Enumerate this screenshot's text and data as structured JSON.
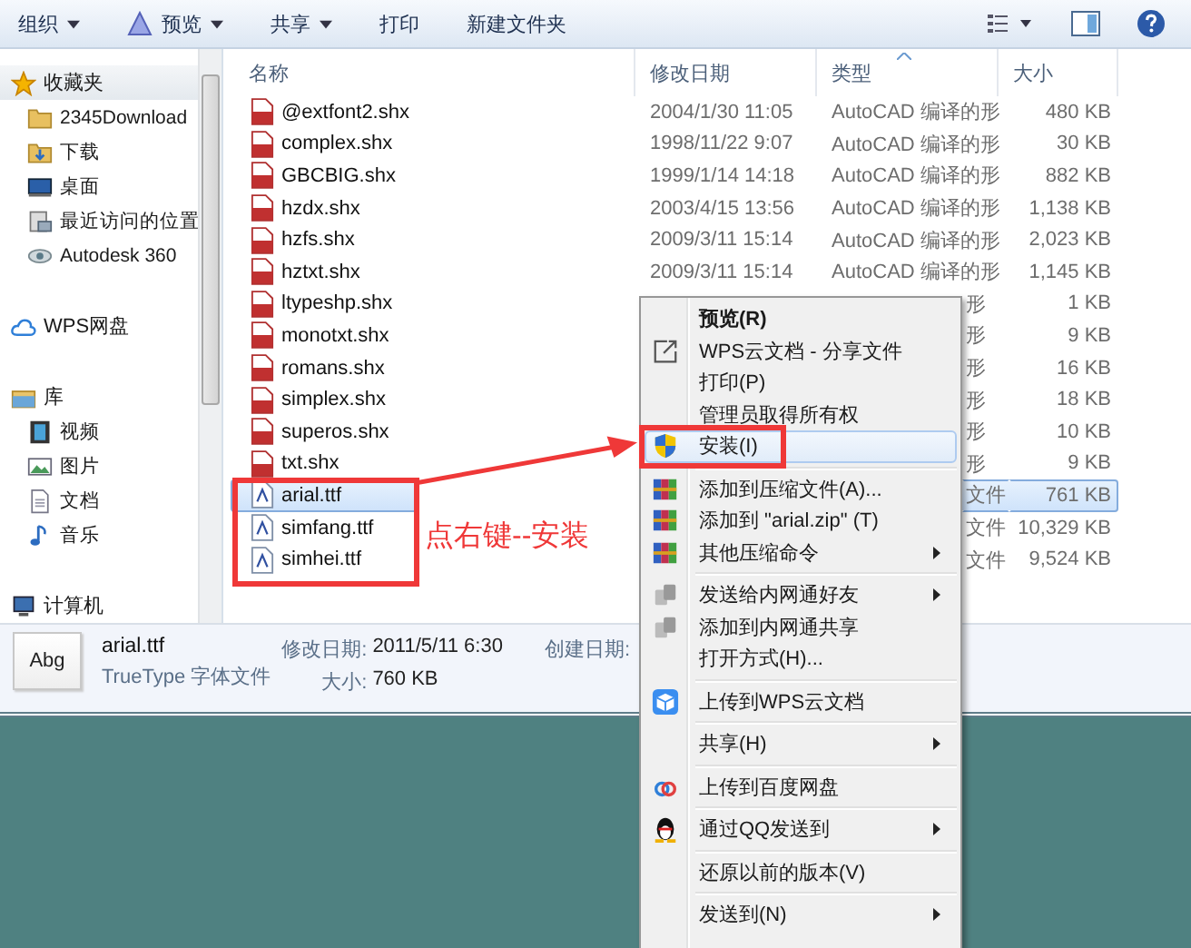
{
  "toolbar": {
    "items": [
      {
        "label": "组织",
        "dropdown": true
      },
      {
        "label": "预览",
        "dropdown": true
      },
      {
        "label": "共享",
        "dropdown": true
      },
      {
        "label": "打印",
        "dropdown": false
      },
      {
        "label": "新建文件夹",
        "dropdown": false
      }
    ]
  },
  "sidebar": {
    "groups": [
      {
        "label": "收藏夹",
        "children": [
          {
            "label": "2345Download"
          },
          {
            "label": "下载"
          },
          {
            "label": "桌面"
          },
          {
            "label": "最近访问的位置"
          },
          {
            "label": "Autodesk 360"
          }
        ]
      },
      {
        "label": "WPS网盘"
      },
      {
        "label": "库",
        "children": [
          {
            "label": "视频"
          },
          {
            "label": "图片"
          },
          {
            "label": "文档"
          },
          {
            "label": "音乐"
          }
        ]
      },
      {
        "label": "计算机"
      }
    ]
  },
  "table": {
    "columns": [
      "名称",
      "修改日期",
      "类型",
      "大小"
    ],
    "rows": [
      {
        "name": "@extfont2.shx",
        "kind": "shx",
        "date": "2004/1/30 11:05",
        "type": "AutoCAD 编译的形",
        "size": "480 KB",
        "selected": false
      },
      {
        "name": "complex.shx",
        "kind": "shx",
        "date": "1998/11/22 9:07",
        "type": "AutoCAD 编译的形",
        "size": "30 KB",
        "selected": false
      },
      {
        "name": "GBCBIG.shx",
        "kind": "shx",
        "date": "1999/1/14 14:18",
        "type": "AutoCAD 编译的形",
        "size": "882 KB",
        "selected": false
      },
      {
        "name": "hzdx.shx",
        "kind": "shx",
        "date": "2003/4/15 13:56",
        "type": "AutoCAD 编译的形",
        "size": "1,138 KB",
        "selected": false
      },
      {
        "name": "hzfs.shx",
        "kind": "shx",
        "date": "2009/3/11 15:14",
        "type": "AutoCAD 编译的形",
        "size": "2,023 KB",
        "selected": false
      },
      {
        "name": "hztxt.shx",
        "kind": "shx",
        "date": "2009/3/11 15:14",
        "type": "AutoCAD 编译的形",
        "size": "1,145 KB",
        "selected": false
      },
      {
        "name": "ltypeshp.shx",
        "kind": "shx",
        "type": "形",
        "size": "1 KB",
        "selected": false
      },
      {
        "name": "monotxt.shx",
        "kind": "shx",
        "type": "形",
        "size": "9 KB",
        "selected": false
      },
      {
        "name": "romans.shx",
        "kind": "shx",
        "type": "形",
        "size": "16 KB",
        "selected": false
      },
      {
        "name": "simplex.shx",
        "kind": "shx",
        "type": "形",
        "size": "18 KB",
        "selected": false
      },
      {
        "name": "superos.shx",
        "kind": "shx",
        "type": "形",
        "size": "10 KB",
        "selected": false
      },
      {
        "name": "txt.shx",
        "kind": "shx",
        "type": "形",
        "size": "9 KB",
        "selected": false
      },
      {
        "name": "arial.ttf",
        "kind": "ttf",
        "type": "文件",
        "size": "761 KB",
        "selected": true
      },
      {
        "name": "simfang.ttf",
        "kind": "ttf",
        "type": "文件",
        "size": "10,329 KB",
        "selected": false
      },
      {
        "name": "simhei.ttf",
        "kind": "ttf",
        "type": "文件",
        "size": "9,524 KB",
        "selected": false
      }
    ]
  },
  "details": {
    "thumbnail": "Abg",
    "name": "arial.ttf",
    "type": "TrueType 字体文件",
    "fields": [
      {
        "label": "修改日期:",
        "value": "2011/5/11 6:30"
      },
      {
        "label": "大小:",
        "value": "760 KB"
      }
    ],
    "created_label": "创建日期:"
  },
  "context_menu": {
    "items": [
      {
        "kind": "item",
        "label": "预览(R)",
        "bold": true,
        "submenu": false,
        "selected": false
      },
      {
        "kind": "item",
        "label": "WPS云文档 - 分享文件",
        "bold": false,
        "submenu": false,
        "selected": false
      },
      {
        "kind": "item",
        "label": "打印(P)",
        "bold": false,
        "submenu": false,
        "selected": false
      },
      {
        "kind": "item",
        "label": "管理员取得所有权",
        "bold": false,
        "submenu": false,
        "selected": false
      },
      {
        "kind": "item",
        "label": "安装(I)",
        "bold": false,
        "submenu": false,
        "selected": true
      },
      {
        "kind": "separator"
      },
      {
        "kind": "item",
        "label": "添加到压缩文件(A)...",
        "bold": false,
        "submenu": false,
        "selected": false
      },
      {
        "kind": "item",
        "label": "添加到 \"arial.zip\" (T)",
        "bold": false,
        "submenu": false,
        "selected": false
      },
      {
        "kind": "item",
        "label": "其他压缩命令",
        "bold": false,
        "submenu": true,
        "selected": false
      },
      {
        "kind": "separator"
      },
      {
        "kind": "item",
        "label": "发送给内网通好友",
        "bold": false,
        "submenu": true,
        "selected": false
      },
      {
        "kind": "item",
        "label": "添加到内网通共享",
        "bold": false,
        "submenu": false,
        "selected": false
      },
      {
        "kind": "item",
        "label": "打开方式(H)...",
        "bold": false,
        "submenu": false,
        "selected": false
      },
      {
        "kind": "separator"
      },
      {
        "kind": "item",
        "label": "上传到WPS云文档",
        "bold": false,
        "submenu": false,
        "selected": false
      },
      {
        "kind": "separator"
      },
      {
        "kind": "item",
        "label": "共享(H)",
        "bold": false,
        "submenu": true,
        "selected": false
      },
      {
        "kind": "separator"
      },
      {
        "kind": "item",
        "label": "上传到百度网盘",
        "bold": false,
        "submenu": false,
        "selected": false
      },
      {
        "kind": "separator"
      },
      {
        "kind": "item",
        "label": "通过QQ发送到",
        "bold": false,
        "submenu": true,
        "selected": false
      },
      {
        "kind": "separator"
      },
      {
        "kind": "item",
        "label": "还原以前的版本(V)",
        "bold": false,
        "submenu": false,
        "selected": false
      },
      {
        "kind": "separator"
      },
      {
        "kind": "item",
        "label": "发送到(N)",
        "bold": false,
        "submenu": true,
        "selected": false
      }
    ]
  },
  "annotation": {
    "label": "点右键--安装"
  }
}
